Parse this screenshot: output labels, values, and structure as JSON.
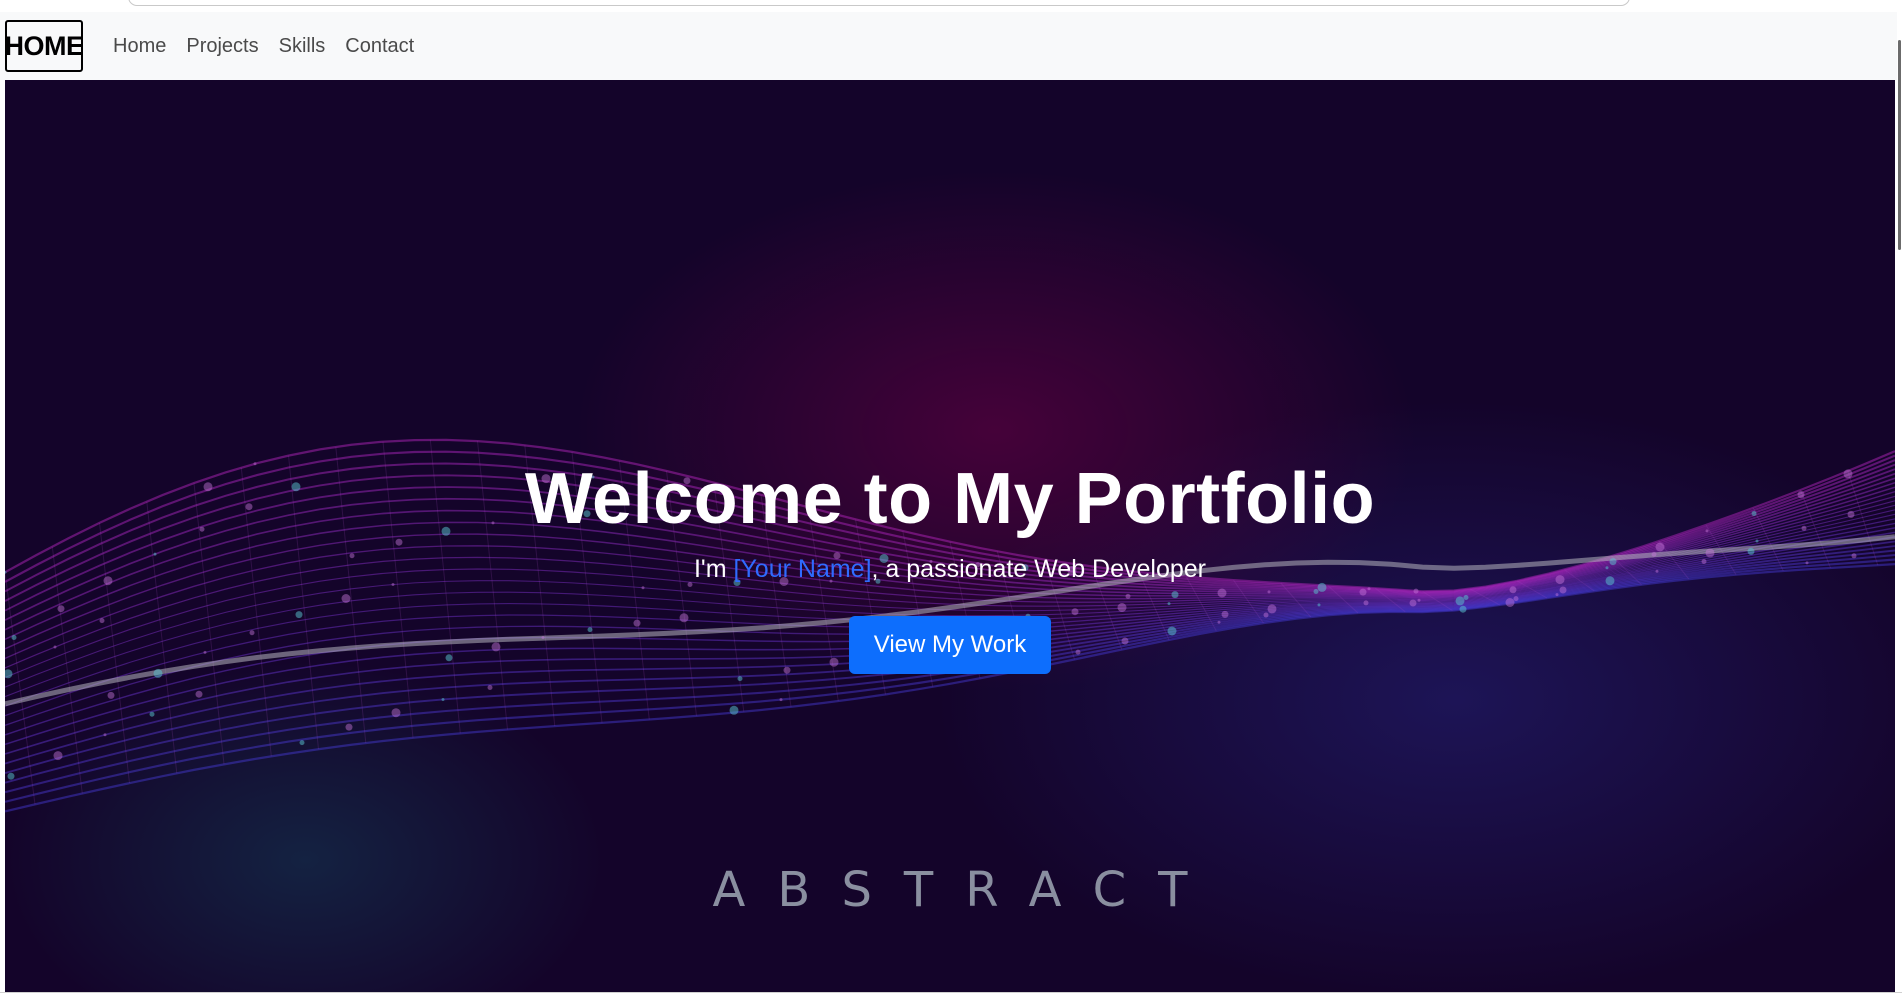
{
  "navbar": {
    "brand": "HOME",
    "links": [
      {
        "label": "Home"
      },
      {
        "label": "Projects"
      },
      {
        "label": "Skills"
      },
      {
        "label": "Contact"
      }
    ]
  },
  "hero": {
    "title": "Welcome to My Portfolio",
    "subtitle_prefix": "I'm ",
    "subtitle_name": "[Your Name]",
    "subtitle_suffix": ", a passionate Web Developer",
    "cta_label": "View My Work",
    "background_word": "ABSTRACT"
  },
  "colors": {
    "navbar_bg": "#f8f9fa",
    "hero_bg": "#14042a",
    "accent": "#0d6efd",
    "name_color": "#2f6bff",
    "abstract_text": "#8a8fa0"
  }
}
